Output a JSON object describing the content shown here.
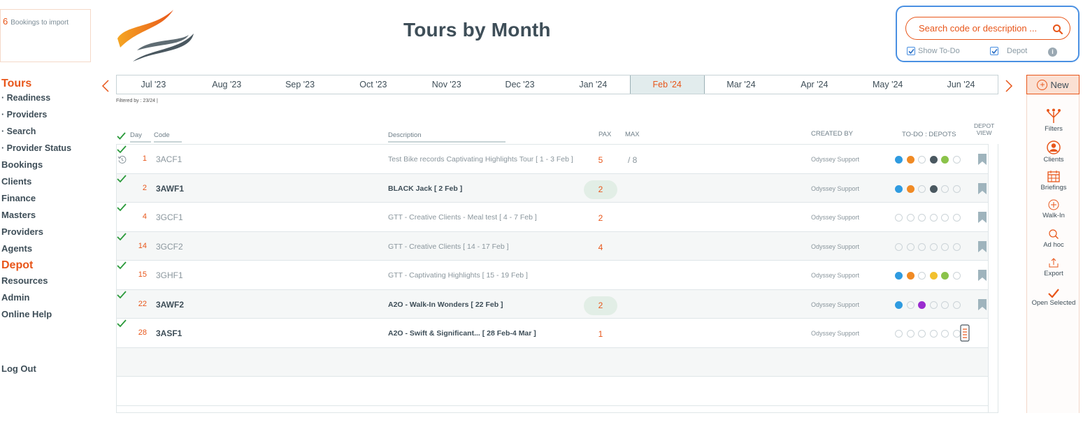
{
  "import": {
    "count": "6",
    "label": "Bookings to import"
  },
  "title": "Tours by Month",
  "search": {
    "placeholder": "Search code or description ...",
    "show_todo": "Show To-Do",
    "depot": "Depot"
  },
  "nav": {
    "tours": "Tours",
    "readiness": "· Readiness",
    "providers_sub": "· Providers",
    "search": "· Search",
    "provider_status": "· Provider Status",
    "bookings": "Bookings",
    "clients": "Clients",
    "finance": "Finance",
    "masters": "Masters",
    "providers": "Providers",
    "agents": "Agents",
    "depot": "Depot",
    "resources": "Resources",
    "admin": "Admin",
    "online_help": "Online Help",
    "logout": "Log Out"
  },
  "months": [
    "Jul '23",
    "Aug '23",
    "Sep '23",
    "Oct '23",
    "Nov '23",
    "Dec '23",
    "Jan '24",
    "Feb '24",
    "Mar '24",
    "Apr '24",
    "May '24",
    "Jun '24"
  ],
  "filtered_by": "Filtered by : 23/24 |",
  "columns": {
    "day": "Day",
    "code": "Code",
    "description": "Description",
    "pax": "PAX",
    "max": "MAX",
    "created_by": "CREATED BY",
    "todo": "TO-DO : DEPOTS",
    "depot_view_1": "DEPOT",
    "depot_view_2": "VIEW"
  },
  "rows": [
    {
      "day": "1",
      "code": "3ACF1",
      "description": "Test Bike records Captivating Highlights Tour  [ 1 - 3 Feb ]",
      "pax": "5",
      "max": "/ 8",
      "created_by": "Odyssey Support"
    },
    {
      "day": "2",
      "code": "3AWF1",
      "description": "BLACK Jack  [ 2 Feb ]",
      "pax": "2",
      "max": "",
      "created_by": "Odyssey Support"
    },
    {
      "day": "4",
      "code": "3GCF1",
      "description": "GTT - Creative Clients - Meal test  [ 4 - 7 Feb ]",
      "pax": "2",
      "max": "",
      "created_by": "Odyssey Support"
    },
    {
      "day": "14",
      "code": "3GCF2",
      "description": "GTT - Creative Clients  [ 14 - 17 Feb ]",
      "pax": "4",
      "max": "",
      "created_by": "Odyssey Support"
    },
    {
      "day": "15",
      "code": "3GHF1",
      "description": "GTT - Captivating Highlights  [ 15 - 19 Feb ]",
      "pax": "",
      "max": "",
      "created_by": "Odyssey Support"
    },
    {
      "day": "22",
      "code": "3AWF2",
      "description": "A2O - Walk-In Wonders  [ 22 Feb ]",
      "pax": "2",
      "max": "",
      "created_by": "Odyssey Support"
    },
    {
      "day": "28",
      "code": "3ASF1",
      "description": "A2O - Swift & Significant...  [ 28 Feb-4 Mar ]",
      "pax": "1",
      "max": "",
      "created_by": "Odyssey Support"
    }
  ],
  "toolbar": {
    "new": "New",
    "filters": "Filters",
    "clients": "Clients",
    "briefings": "Briefings",
    "walkin": "Walk-In",
    "adhoc": "Ad hoc",
    "export": "Export",
    "open_selected": "Open Selected"
  },
  "colors": {
    "accent": "#e8561a",
    "text": "#3e4e58",
    "blue": "#2f9be0",
    "orange": "#f08a24",
    "dark": "#4a5860",
    "green": "#8bc34a",
    "yellow": "#f2c12e",
    "purple": "#9a2ccf"
  }
}
